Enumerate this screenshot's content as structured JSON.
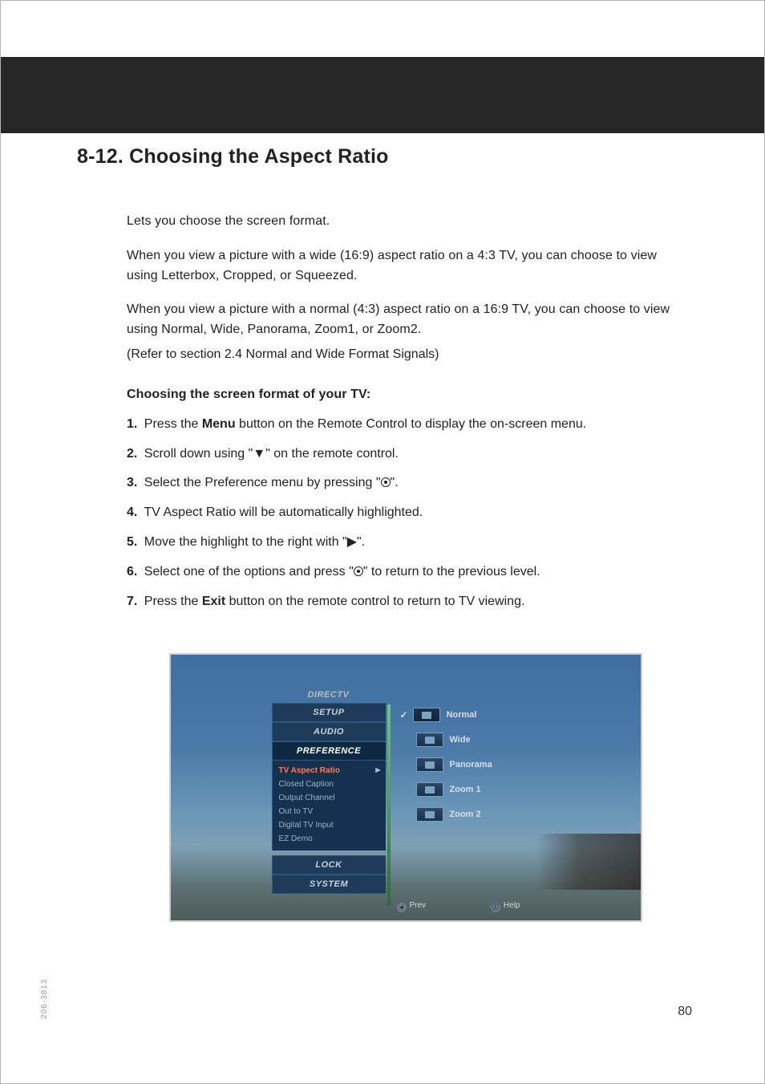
{
  "header": {
    "title": "8-12. Choosing the Aspect Ratio"
  },
  "intro": {
    "p1": " Lets you choose the screen format.",
    "p2": "When you view a picture with a wide (16:9) aspect ratio on a 4:3 TV, you can choose to view using Letterbox, Cropped, or Squeezed.",
    "p3": "When you view a picture with a normal (4:3) aspect ratio on a 16:9 TV, you can choose to view using Normal, Wide, Panorama, Zoom1, or Zoom2.",
    "p4": "(Refer to section 2.4 Normal and Wide Format Signals)"
  },
  "subhead": "Choosing the screen format of your TV:",
  "steps": {
    "s1_num": "1.",
    "s1a": " Press the ",
    "s1_bold": "Menu",
    "s1b": " button on the Remote Control to display the on-screen menu.",
    "s2_num": "2.",
    "s2a": " Scroll down using \"",
    "s2_sym": "▼",
    "s2b": "\" on the remote control.",
    "s3_num": "3.",
    "s3a": " Select the Preference menu by pressing \"",
    "s3b": "\".",
    "s4_num": "4.",
    "s4": " TV Aspect Ratio will be automatically highlighted.",
    "s5_num": "5.",
    "s5a": " Move the highlight to the right with \"",
    "s5_sym": "▶",
    "s5b": "\".",
    "s6_num": "6.",
    "s6a": " Select one of the options and press \"",
    "s6b": "\" to return to the previous level.",
    "s7_num": "7.",
    "s7a": " Press the ",
    "s7_bold": "Exit",
    "s7b": " button on the remote control to return to TV viewing."
  },
  "osd": {
    "brand": "DIRECTV",
    "sections": {
      "setup": "SETUP",
      "audio": "AUDIO",
      "preference": "PREFERENCE",
      "lock": "LOCK",
      "system": "SYSTEM"
    },
    "pref_items": {
      "aspect": "TV Aspect Ratio",
      "cc": "Closed Caption",
      "out_ch": "Output Channel",
      "out_tv": "Out to TV",
      "dtv": "Digital TV Input",
      "ez": "EZ Demo"
    },
    "options": {
      "normal": "Normal",
      "wide": "Wide",
      "panorama": "Panorama",
      "zoom1": "Zoom 1",
      "zoom2": "Zoom 2"
    },
    "hints": {
      "prev": "Prev",
      "help": "Help"
    },
    "check": "✓"
  },
  "footer": {
    "pageNumber": "80",
    "docCode": "206-3813"
  }
}
